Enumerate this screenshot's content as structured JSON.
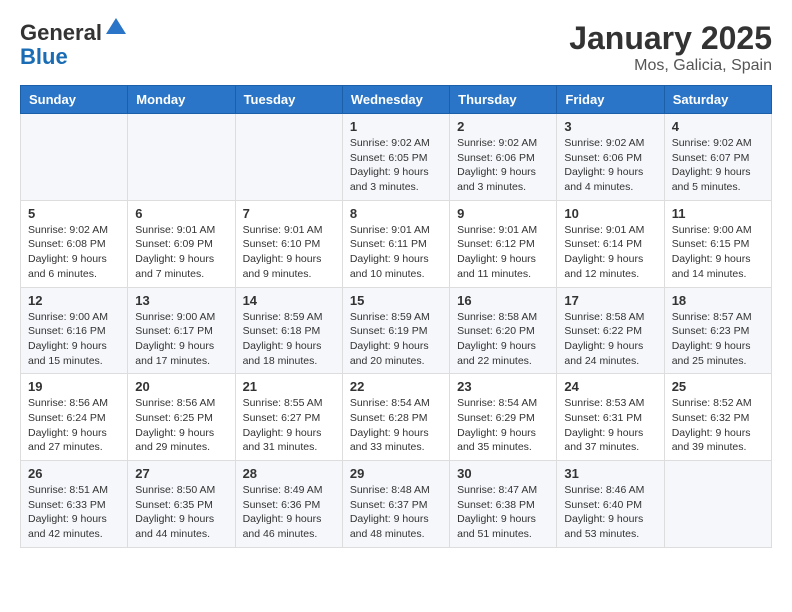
{
  "logo": {
    "general": "General",
    "blue": "Blue"
  },
  "title": "January 2025",
  "subtitle": "Mos, Galicia, Spain",
  "days_of_week": [
    "Sunday",
    "Monday",
    "Tuesday",
    "Wednesday",
    "Thursday",
    "Friday",
    "Saturday"
  ],
  "weeks": [
    [
      {
        "day": "",
        "info": ""
      },
      {
        "day": "",
        "info": ""
      },
      {
        "day": "",
        "info": ""
      },
      {
        "day": "1",
        "info": "Sunrise: 9:02 AM\nSunset: 6:05 PM\nDaylight: 9 hours and 3 minutes."
      },
      {
        "day": "2",
        "info": "Sunrise: 9:02 AM\nSunset: 6:06 PM\nDaylight: 9 hours and 3 minutes."
      },
      {
        "day": "3",
        "info": "Sunrise: 9:02 AM\nSunset: 6:06 PM\nDaylight: 9 hours and 4 minutes."
      },
      {
        "day": "4",
        "info": "Sunrise: 9:02 AM\nSunset: 6:07 PM\nDaylight: 9 hours and 5 minutes."
      }
    ],
    [
      {
        "day": "5",
        "info": "Sunrise: 9:02 AM\nSunset: 6:08 PM\nDaylight: 9 hours and 6 minutes."
      },
      {
        "day": "6",
        "info": "Sunrise: 9:01 AM\nSunset: 6:09 PM\nDaylight: 9 hours and 7 minutes."
      },
      {
        "day": "7",
        "info": "Sunrise: 9:01 AM\nSunset: 6:10 PM\nDaylight: 9 hours and 9 minutes."
      },
      {
        "day": "8",
        "info": "Sunrise: 9:01 AM\nSunset: 6:11 PM\nDaylight: 9 hours and 10 minutes."
      },
      {
        "day": "9",
        "info": "Sunrise: 9:01 AM\nSunset: 6:12 PM\nDaylight: 9 hours and 11 minutes."
      },
      {
        "day": "10",
        "info": "Sunrise: 9:01 AM\nSunset: 6:14 PM\nDaylight: 9 hours and 12 minutes."
      },
      {
        "day": "11",
        "info": "Sunrise: 9:00 AM\nSunset: 6:15 PM\nDaylight: 9 hours and 14 minutes."
      }
    ],
    [
      {
        "day": "12",
        "info": "Sunrise: 9:00 AM\nSunset: 6:16 PM\nDaylight: 9 hours and 15 minutes."
      },
      {
        "day": "13",
        "info": "Sunrise: 9:00 AM\nSunset: 6:17 PM\nDaylight: 9 hours and 17 minutes."
      },
      {
        "day": "14",
        "info": "Sunrise: 8:59 AM\nSunset: 6:18 PM\nDaylight: 9 hours and 18 minutes."
      },
      {
        "day": "15",
        "info": "Sunrise: 8:59 AM\nSunset: 6:19 PM\nDaylight: 9 hours and 20 minutes."
      },
      {
        "day": "16",
        "info": "Sunrise: 8:58 AM\nSunset: 6:20 PM\nDaylight: 9 hours and 22 minutes."
      },
      {
        "day": "17",
        "info": "Sunrise: 8:58 AM\nSunset: 6:22 PM\nDaylight: 9 hours and 24 minutes."
      },
      {
        "day": "18",
        "info": "Sunrise: 8:57 AM\nSunset: 6:23 PM\nDaylight: 9 hours and 25 minutes."
      }
    ],
    [
      {
        "day": "19",
        "info": "Sunrise: 8:56 AM\nSunset: 6:24 PM\nDaylight: 9 hours and 27 minutes."
      },
      {
        "day": "20",
        "info": "Sunrise: 8:56 AM\nSunset: 6:25 PM\nDaylight: 9 hours and 29 minutes."
      },
      {
        "day": "21",
        "info": "Sunrise: 8:55 AM\nSunset: 6:27 PM\nDaylight: 9 hours and 31 minutes."
      },
      {
        "day": "22",
        "info": "Sunrise: 8:54 AM\nSunset: 6:28 PM\nDaylight: 9 hours and 33 minutes."
      },
      {
        "day": "23",
        "info": "Sunrise: 8:54 AM\nSunset: 6:29 PM\nDaylight: 9 hours and 35 minutes."
      },
      {
        "day": "24",
        "info": "Sunrise: 8:53 AM\nSunset: 6:31 PM\nDaylight: 9 hours and 37 minutes."
      },
      {
        "day": "25",
        "info": "Sunrise: 8:52 AM\nSunset: 6:32 PM\nDaylight: 9 hours and 39 minutes."
      }
    ],
    [
      {
        "day": "26",
        "info": "Sunrise: 8:51 AM\nSunset: 6:33 PM\nDaylight: 9 hours and 42 minutes."
      },
      {
        "day": "27",
        "info": "Sunrise: 8:50 AM\nSunset: 6:35 PM\nDaylight: 9 hours and 44 minutes."
      },
      {
        "day": "28",
        "info": "Sunrise: 8:49 AM\nSunset: 6:36 PM\nDaylight: 9 hours and 46 minutes."
      },
      {
        "day": "29",
        "info": "Sunrise: 8:48 AM\nSunset: 6:37 PM\nDaylight: 9 hours and 48 minutes."
      },
      {
        "day": "30",
        "info": "Sunrise: 8:47 AM\nSunset: 6:38 PM\nDaylight: 9 hours and 51 minutes."
      },
      {
        "day": "31",
        "info": "Sunrise: 8:46 AM\nSunset: 6:40 PM\nDaylight: 9 hours and 53 minutes."
      },
      {
        "day": "",
        "info": ""
      }
    ]
  ]
}
